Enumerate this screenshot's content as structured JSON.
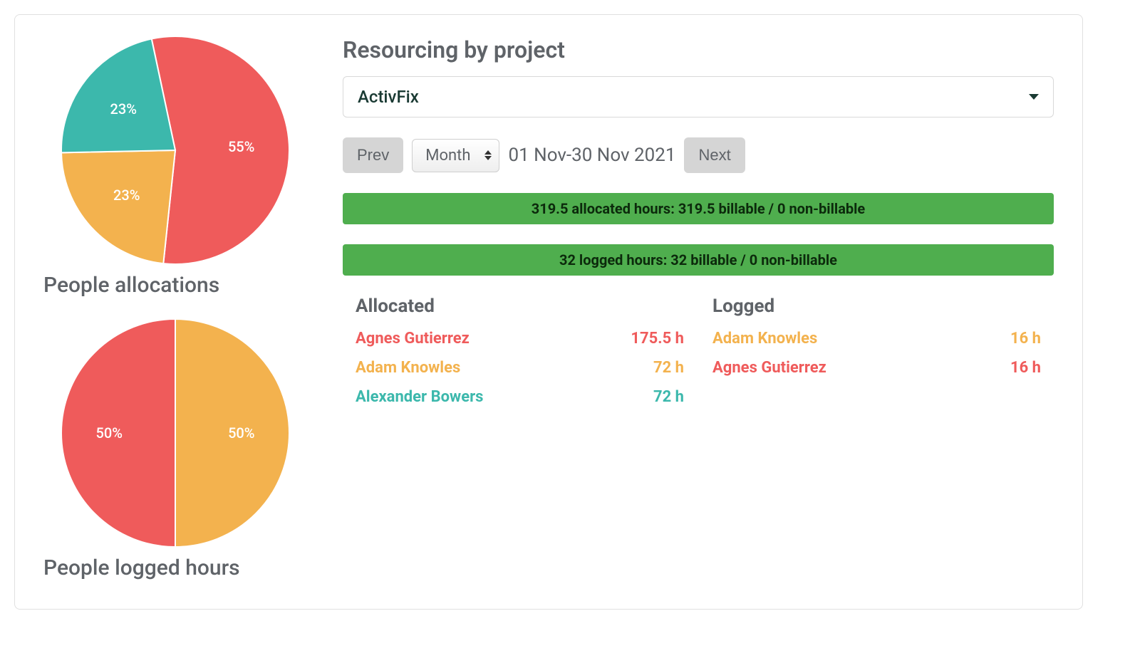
{
  "colors": {
    "red": "#ef5b5b",
    "orange": "#f3b24e",
    "teal": "#3cb8ac"
  },
  "heading": "Resourcing by project",
  "project": "ActivFix",
  "nav": {
    "prev": "Prev",
    "period": "Month",
    "range": "01 Nov-30 Nov 2021",
    "next": "Next"
  },
  "bars": {
    "allocated": "319.5 allocated hours: 319.5 billable / 0 non-billable",
    "logged": "32 logged hours: 32 billable / 0 non-billable"
  },
  "allocated": {
    "title": "Allocated",
    "rows": [
      {
        "name": "Agnes Gutierrez",
        "hours": "175.5 h",
        "colorKey": "red"
      },
      {
        "name": "Adam Knowles",
        "hours": "72 h",
        "colorKey": "orange"
      },
      {
        "name": "Alexander Bowers",
        "hours": "72 h",
        "colorKey": "teal"
      }
    ]
  },
  "logged": {
    "title": "Logged",
    "rows": [
      {
        "name": "Adam Knowles",
        "hours": "16 h",
        "colorKey": "orange"
      },
      {
        "name": "Agnes Gutierrez",
        "hours": "16 h",
        "colorKey": "red"
      }
    ]
  },
  "charts": {
    "allocations": {
      "title": "People allocations",
      "slices": [
        {
          "label": "55%",
          "value": 55,
          "colorKey": "red"
        },
        {
          "label": "23%",
          "value": 23,
          "colorKey": "orange"
        },
        {
          "label": "23%",
          "value": 22,
          "colorKey": "teal"
        }
      ]
    },
    "loggedHours": {
      "title": "People logged hours",
      "slices": [
        {
          "label": "50%",
          "value": 50,
          "colorKey": "orange"
        },
        {
          "label": "50%",
          "value": 50,
          "colorKey": "red"
        }
      ]
    }
  },
  "chart_data": [
    {
      "type": "pie",
      "title": "People allocations",
      "series": [
        {
          "name": "Agnes Gutierrez",
          "value": 55,
          "label": "55%"
        },
        {
          "name": "Adam Knowles",
          "value": 23,
          "label": "23%"
        },
        {
          "name": "Alexander Bowers",
          "value": 22,
          "label": "23%"
        }
      ]
    },
    {
      "type": "pie",
      "title": "People logged hours",
      "series": [
        {
          "name": "Adam Knowles",
          "value": 50,
          "label": "50%"
        },
        {
          "name": "Agnes Gutierrez",
          "value": 50,
          "label": "50%"
        }
      ]
    }
  ]
}
